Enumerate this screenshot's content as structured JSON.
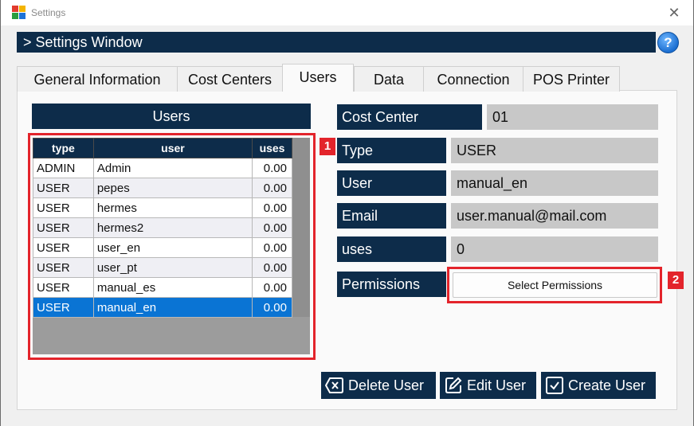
{
  "window": {
    "title": "Settings",
    "close_glyph": "✕"
  },
  "header": {
    "title": "> Settings Window",
    "help_glyph": "?"
  },
  "tabs": [
    {
      "label": "General Information"
    },
    {
      "label": "Cost Centers"
    },
    {
      "label": "Users"
    },
    {
      "label": "Data"
    },
    {
      "label": "Connection"
    },
    {
      "label": "POS Printer"
    }
  ],
  "active_tab": "Users",
  "users_panel": {
    "title": "Users",
    "columns": [
      "type",
      "user",
      "uses"
    ],
    "rows": [
      {
        "type": "ADMIN",
        "user": "Admin",
        "uses": "0.00"
      },
      {
        "type": "USER",
        "user": "pepes",
        "uses": "0.00"
      },
      {
        "type": "USER",
        "user": "hermes",
        "uses": "0.00"
      },
      {
        "type": "USER",
        "user": "hermes2",
        "uses": "0.00"
      },
      {
        "type": "USER",
        "user": "user_en",
        "uses": "0.00"
      },
      {
        "type": "USER",
        "user": "user_pt",
        "uses": "0.00"
      },
      {
        "type": "USER",
        "user": "manual_es",
        "uses": "0.00"
      },
      {
        "type": "USER",
        "user": "manual_en",
        "uses": "0.00"
      }
    ],
    "selected_index": 7
  },
  "callouts": {
    "one": "1",
    "two": "2"
  },
  "detail": {
    "cost_center_label": "Cost Center",
    "cost_center_value": "01",
    "type_label": "Type",
    "type_value": "USER",
    "user_label": "User",
    "user_value": "manual_en",
    "email_label": "Email",
    "email_value": "user.manual@mail.com",
    "uses_label": "uses",
    "uses_value": "0",
    "permissions_label": "Permissions",
    "permissions_button": "Select Permissions"
  },
  "actions": {
    "delete": "Delete User",
    "edit": "Edit User",
    "create": "Create User"
  },
  "colors": {
    "navy": "#0d2c4a",
    "selection": "#0a74d4",
    "callout": "#e3242b"
  }
}
